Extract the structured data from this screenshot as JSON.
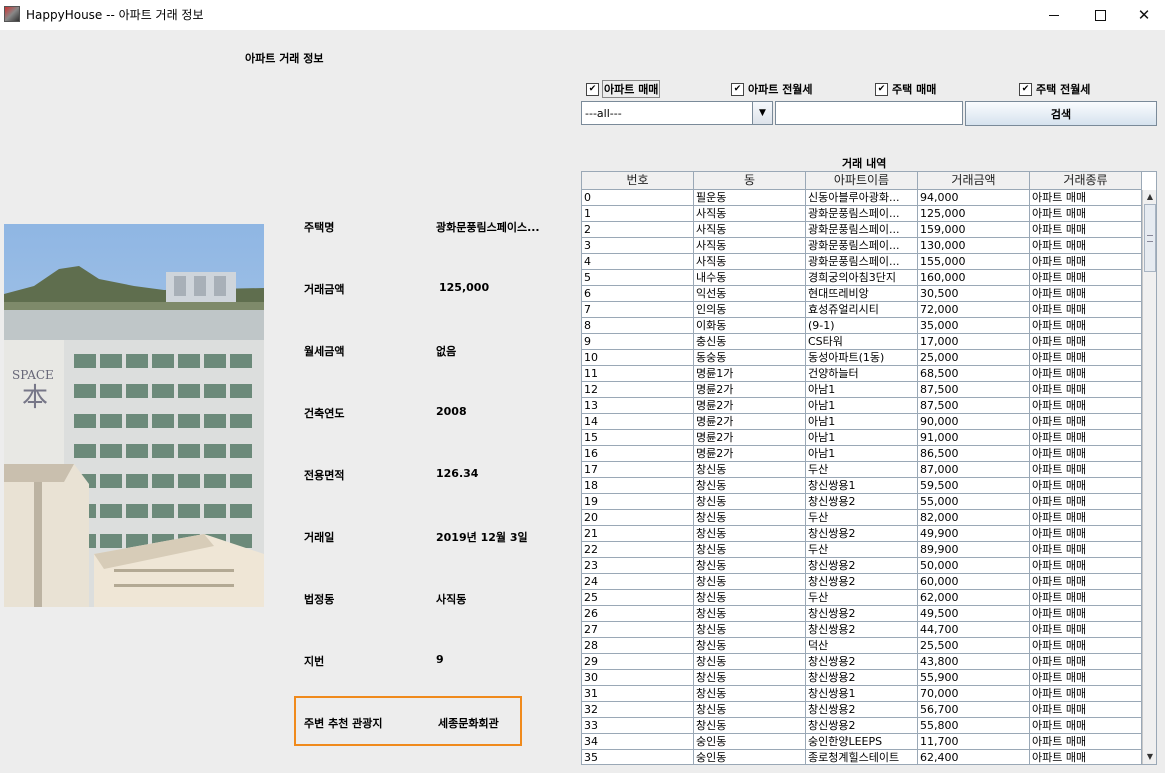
{
  "window": {
    "title": "HappyHouse -- 아파트 거래 정보"
  },
  "left_panel": {
    "title": "아파트 거래 정보",
    "fields": [
      {
        "label": "주택명",
        "value": "광화문풍림스페이스..."
      },
      {
        "label": "거래금액",
        "value": "125,000"
      },
      {
        "label": "월세금액",
        "value": "없음"
      },
      {
        "label": "건축연도",
        "value": "2008"
      },
      {
        "label": "전용면적",
        "value": "126.34"
      },
      {
        "label": "거래일",
        "value": "2019년 12월 3일"
      },
      {
        "label": "법정동",
        "value": "사직동"
      },
      {
        "label": "지번",
        "value": "9"
      },
      {
        "label": "주변 추천 관광지",
        "value": "세종문화회관"
      }
    ]
  },
  "filters": {
    "checkboxes": [
      {
        "label": "아파트 매매",
        "checked": true
      },
      {
        "label": "아파트 전월세",
        "checked": true
      },
      {
        "label": "주택 매매",
        "checked": true
      },
      {
        "label": "주택 전월세",
        "checked": true
      }
    ],
    "combo_value": "---all---",
    "search_value": "",
    "search_button": "검색"
  },
  "table": {
    "title": "거래 내역",
    "columns": [
      "번호",
      "동",
      "아파트이름",
      "거래금액",
      "거래종류"
    ],
    "rows": [
      [
        "0",
        "필운동",
        "신동아블루아광화...",
        "94,000",
        "아파트 매매"
      ],
      [
        "1",
        "사직동",
        "광화문풍림스페이...",
        "125,000",
        "아파트 매매"
      ],
      [
        "2",
        "사직동",
        "광화문풍림스페이...",
        "159,000",
        "아파트 매매"
      ],
      [
        "3",
        "사직동",
        "광화문풍림스페이...",
        "130,000",
        "아파트 매매"
      ],
      [
        "4",
        "사직동",
        "광화문풍림스페이...",
        "155,000",
        "아파트 매매"
      ],
      [
        "5",
        "내수동",
        "경희궁의아침3단지",
        "160,000",
        "아파트 매매"
      ],
      [
        "6",
        "익선동",
        "현대뜨레비앙",
        "30,500",
        "아파트 매매"
      ],
      [
        "7",
        "인의동",
        "효성쥬얼리시티",
        "72,000",
        "아파트 매매"
      ],
      [
        "8",
        "이화동",
        "(9-1)",
        "35,000",
        "아파트 매매"
      ],
      [
        "9",
        "충신동",
        "CS타워",
        "17,000",
        "아파트 매매"
      ],
      [
        "10",
        "동숭동",
        "동성아파트(1동)",
        "25,000",
        "아파트 매매"
      ],
      [
        "11",
        "명륜1가",
        "건양하늘터",
        "68,500",
        "아파트 매매"
      ],
      [
        "12",
        "명륜2가",
        "아남1",
        "87,500",
        "아파트 매매"
      ],
      [
        "13",
        "명륜2가",
        "아남1",
        "87,500",
        "아파트 매매"
      ],
      [
        "14",
        "명륜2가",
        "아남1",
        "90,000",
        "아파트 매매"
      ],
      [
        "15",
        "명륜2가",
        "아남1",
        "91,000",
        "아파트 매매"
      ],
      [
        "16",
        "명륜2가",
        "아남1",
        "86,500",
        "아파트 매매"
      ],
      [
        "17",
        "창신동",
        "두산",
        "87,000",
        "아파트 매매"
      ],
      [
        "18",
        "창신동",
        "창신쌍용1",
        "59,500",
        "아파트 매매"
      ],
      [
        "19",
        "창신동",
        "창신쌍용2",
        "55,000",
        "아파트 매매"
      ],
      [
        "20",
        "창신동",
        "두산",
        "82,000",
        "아파트 매매"
      ],
      [
        "21",
        "창신동",
        "창신쌍용2",
        "49,900",
        "아파트 매매"
      ],
      [
        "22",
        "창신동",
        "두산",
        "89,900",
        "아파트 매매"
      ],
      [
        "23",
        "창신동",
        "창신쌍용2",
        "50,000",
        "아파트 매매"
      ],
      [
        "24",
        "창신동",
        "창신쌍용2",
        "60,000",
        "아파트 매매"
      ],
      [
        "25",
        "창신동",
        "두산",
        "62,000",
        "아파트 매매"
      ],
      [
        "26",
        "창신동",
        "창신쌍용2",
        "49,500",
        "아파트 매매"
      ],
      [
        "27",
        "창신동",
        "창신쌍용2",
        "44,700",
        "아파트 매매"
      ],
      [
        "28",
        "창신동",
        "덕산",
        "25,500",
        "아파트 매매"
      ],
      [
        "29",
        "창신동",
        "창신쌍용2",
        "43,800",
        "아파트 매매"
      ],
      [
        "30",
        "창신동",
        "창신쌍용2",
        "55,900",
        "아파트 매매"
      ],
      [
        "31",
        "창신동",
        "창신쌍용1",
        "70,000",
        "아파트 매매"
      ],
      [
        "32",
        "창신동",
        "창신쌍용2",
        "56,700",
        "아파트 매매"
      ],
      [
        "33",
        "창신동",
        "창신쌍용2",
        "55,800",
        "아파트 매매"
      ],
      [
        "34",
        "숭인동",
        "숭인한양LEEPS",
        "11,700",
        "아파트 매매"
      ],
      [
        "35",
        "숭인동",
        "종로청계힐스테이트",
        "62,400",
        "아파트 매매"
      ]
    ]
  }
}
